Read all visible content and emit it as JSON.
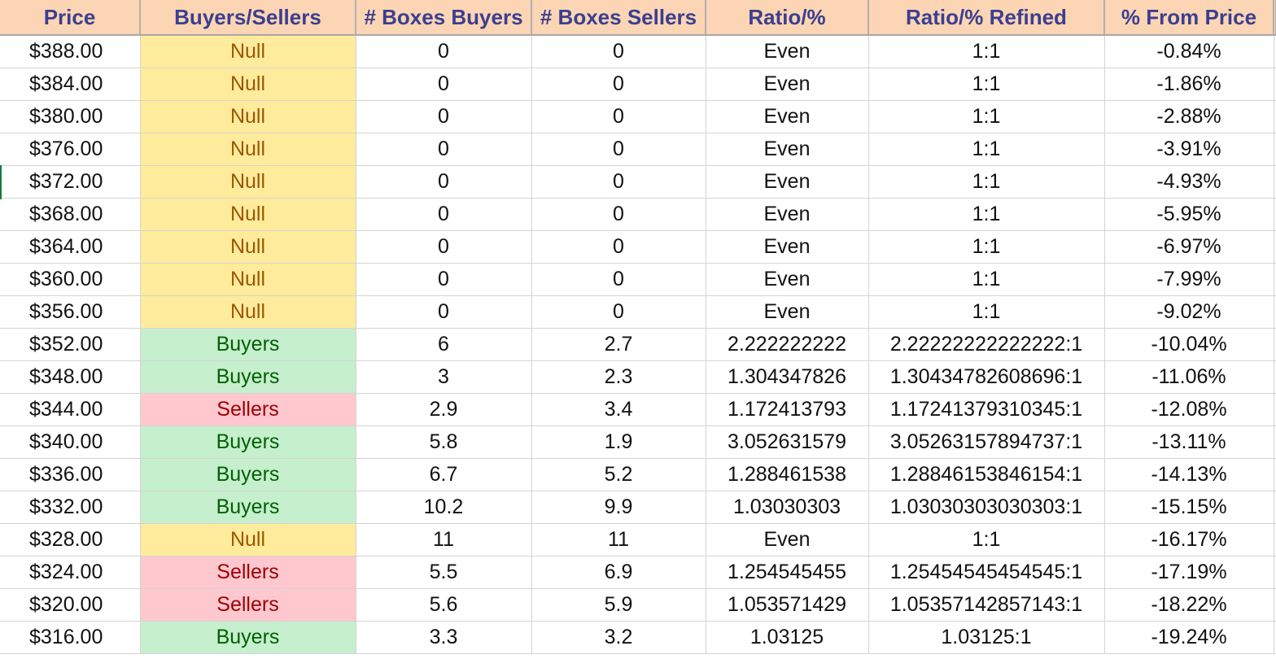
{
  "colors": {
    "header_bg": "#fcd5b4",
    "header_text": "#3b3f8f",
    "null_bg": "#ffeb9c",
    "null_text": "#9c5700",
    "buyers_bg": "#c6efce",
    "buyers_text": "#006100",
    "sellers_bg": "#ffc7ce",
    "sellers_text": "#9c0006",
    "selection": "#107c41"
  },
  "headers": [
    "Price",
    "Buyers/Sellers",
    "# Boxes Buyers",
    "# Boxes Sellers",
    "Ratio/%",
    "Ratio/% Refined",
    "% From Price"
  ],
  "rows": [
    {
      "price": "$388.00",
      "side": "Null",
      "buyers": "0",
      "sellers": "0",
      "ratio": "Even",
      "refined": "1:1",
      "from_price": "-0.84%"
    },
    {
      "price": "$384.00",
      "side": "Null",
      "buyers": "0",
      "sellers": "0",
      "ratio": "Even",
      "refined": "1:1",
      "from_price": "-1.86%"
    },
    {
      "price": "$380.00",
      "side": "Null",
      "buyers": "0",
      "sellers": "0",
      "ratio": "Even",
      "refined": "1:1",
      "from_price": "-2.88%"
    },
    {
      "price": "$376.00",
      "side": "Null",
      "buyers": "0",
      "sellers": "0",
      "ratio": "Even",
      "refined": "1:1",
      "from_price": "-3.91%"
    },
    {
      "price": "$372.00",
      "side": "Null",
      "buyers": "0",
      "sellers": "0",
      "ratio": "Even",
      "refined": "1:1",
      "from_price": "-4.93%"
    },
    {
      "price": "$368.00",
      "side": "Null",
      "buyers": "0",
      "sellers": "0",
      "ratio": "Even",
      "refined": "1:1",
      "from_price": "-5.95%"
    },
    {
      "price": "$364.00",
      "side": "Null",
      "buyers": "0",
      "sellers": "0",
      "ratio": "Even",
      "refined": "1:1",
      "from_price": "-6.97%"
    },
    {
      "price": "$360.00",
      "side": "Null",
      "buyers": "0",
      "sellers": "0",
      "ratio": "Even",
      "refined": "1:1",
      "from_price": "-7.99%"
    },
    {
      "price": "$356.00",
      "side": "Null",
      "buyers": "0",
      "sellers": "0",
      "ratio": "Even",
      "refined": "1:1",
      "from_price": "-9.02%"
    },
    {
      "price": "$352.00",
      "side": "Buyers",
      "buyers": "6",
      "sellers": "2.7",
      "ratio": "2.222222222",
      "refined": "2.22222222222222:1",
      "from_price": "-10.04%"
    },
    {
      "price": "$348.00",
      "side": "Buyers",
      "buyers": "3",
      "sellers": "2.3",
      "ratio": "1.304347826",
      "refined": "1.30434782608696:1",
      "from_price": "-11.06%"
    },
    {
      "price": "$344.00",
      "side": "Sellers",
      "buyers": "2.9",
      "sellers": "3.4",
      "ratio": "1.172413793",
      "refined": "1.17241379310345:1",
      "from_price": "-12.08%"
    },
    {
      "price": "$340.00",
      "side": "Buyers",
      "buyers": "5.8",
      "sellers": "1.9",
      "ratio": "3.052631579",
      "refined": "3.05263157894737:1",
      "from_price": "-13.11%"
    },
    {
      "price": "$336.00",
      "side": "Buyers",
      "buyers": "6.7",
      "sellers": "5.2",
      "ratio": "1.288461538",
      "refined": "1.28846153846154:1",
      "from_price": "-14.13%"
    },
    {
      "price": "$332.00",
      "side": "Buyers",
      "buyers": "10.2",
      "sellers": "9.9",
      "ratio": "1.03030303",
      "refined": "1.03030303030303:1",
      "from_price": "-15.15%"
    },
    {
      "price": "$328.00",
      "side": "Null",
      "buyers": "11",
      "sellers": "11",
      "ratio": "Even",
      "refined": "1:1",
      "from_price": "-16.17%"
    },
    {
      "price": "$324.00",
      "side": "Sellers",
      "buyers": "5.5",
      "sellers": "6.9",
      "ratio": "1.254545455",
      "refined": "1.25454545454545:1",
      "from_price": "-17.19%"
    },
    {
      "price": "$320.00",
      "side": "Sellers",
      "buyers": "5.6",
      "sellers": "5.9",
      "ratio": "1.053571429",
      "refined": "1.05357142857143:1",
      "from_price": "-18.22%"
    },
    {
      "price": "$316.00",
      "side": "Buyers",
      "buyers": "3.3",
      "sellers": "3.2",
      "ratio": "1.03125",
      "refined": "1.03125:1",
      "from_price": "-19.24%"
    }
  ]
}
